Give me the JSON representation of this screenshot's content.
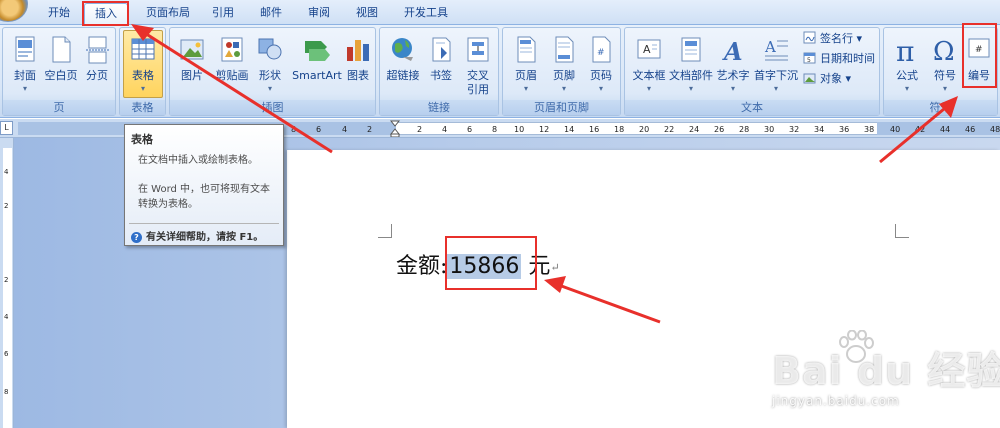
{
  "tabs": [
    {
      "label": "开始"
    },
    {
      "label": "插入"
    },
    {
      "label": "页面布局"
    },
    {
      "label": "引用"
    },
    {
      "label": "邮件"
    },
    {
      "label": "审阅"
    },
    {
      "label": "视图"
    },
    {
      "label": "开发工具"
    }
  ],
  "ribbon": {
    "groups": {
      "pages": "页",
      "table": "表格",
      "illustrations": "插图",
      "links": "链接",
      "header_footer": "页眉和页脚",
      "text": "文本",
      "symbols": "符号"
    },
    "buttons": {
      "cover": "封面",
      "blank": "空白页",
      "page_break": "分页",
      "table": "表格",
      "picture": "图片",
      "clipart": "剪贴画",
      "shapes": "形状",
      "smartart": "SmartArt",
      "chart": "图表",
      "hyperlink": "超链接",
      "bookmark": "书签",
      "crossref_1": "交叉",
      "crossref_2": "引用",
      "header": "页眉",
      "footer": "页脚",
      "page_number": "页码",
      "textbox": "文本框",
      "quickparts": "文档部件",
      "wordart": "艺术字",
      "dropcap": "首字下沉",
      "signature": "签名行",
      "datetime": "日期和时间",
      "object": "对象",
      "equation": "公式",
      "symbol": "符号",
      "numbering": "编号"
    }
  },
  "tooltip": {
    "title": "表格",
    "line1": "在文档中插入或绘制表格。",
    "line2": "在 Word 中，也可将现有文本转换为表格。",
    "help": "有关详细帮助，请按 F1。"
  },
  "ruler": {
    "selector": "L",
    "ticks": [
      "8",
      "6",
      "4",
      "2",
      "2",
      "4",
      "6",
      "8",
      "10",
      "12",
      "14",
      "16",
      "18",
      "20",
      "22",
      "24",
      "26",
      "28",
      "30",
      "32",
      "34",
      "36",
      "38",
      "40",
      "42",
      "44",
      "46",
      "48"
    ],
    "vticks": [
      "4",
      "2",
      "2",
      "4",
      "6",
      "8"
    ]
  },
  "document": {
    "label": "金额:",
    "amount": "15866",
    "unit": "元"
  },
  "watermark": {
    "main": "Bai du 经验",
    "url": "jingyan.baidu.com"
  },
  "colors": {
    "highlight": "#e8302b",
    "ribbon": "#dde9f8",
    "selection": "#b6cbe6"
  }
}
